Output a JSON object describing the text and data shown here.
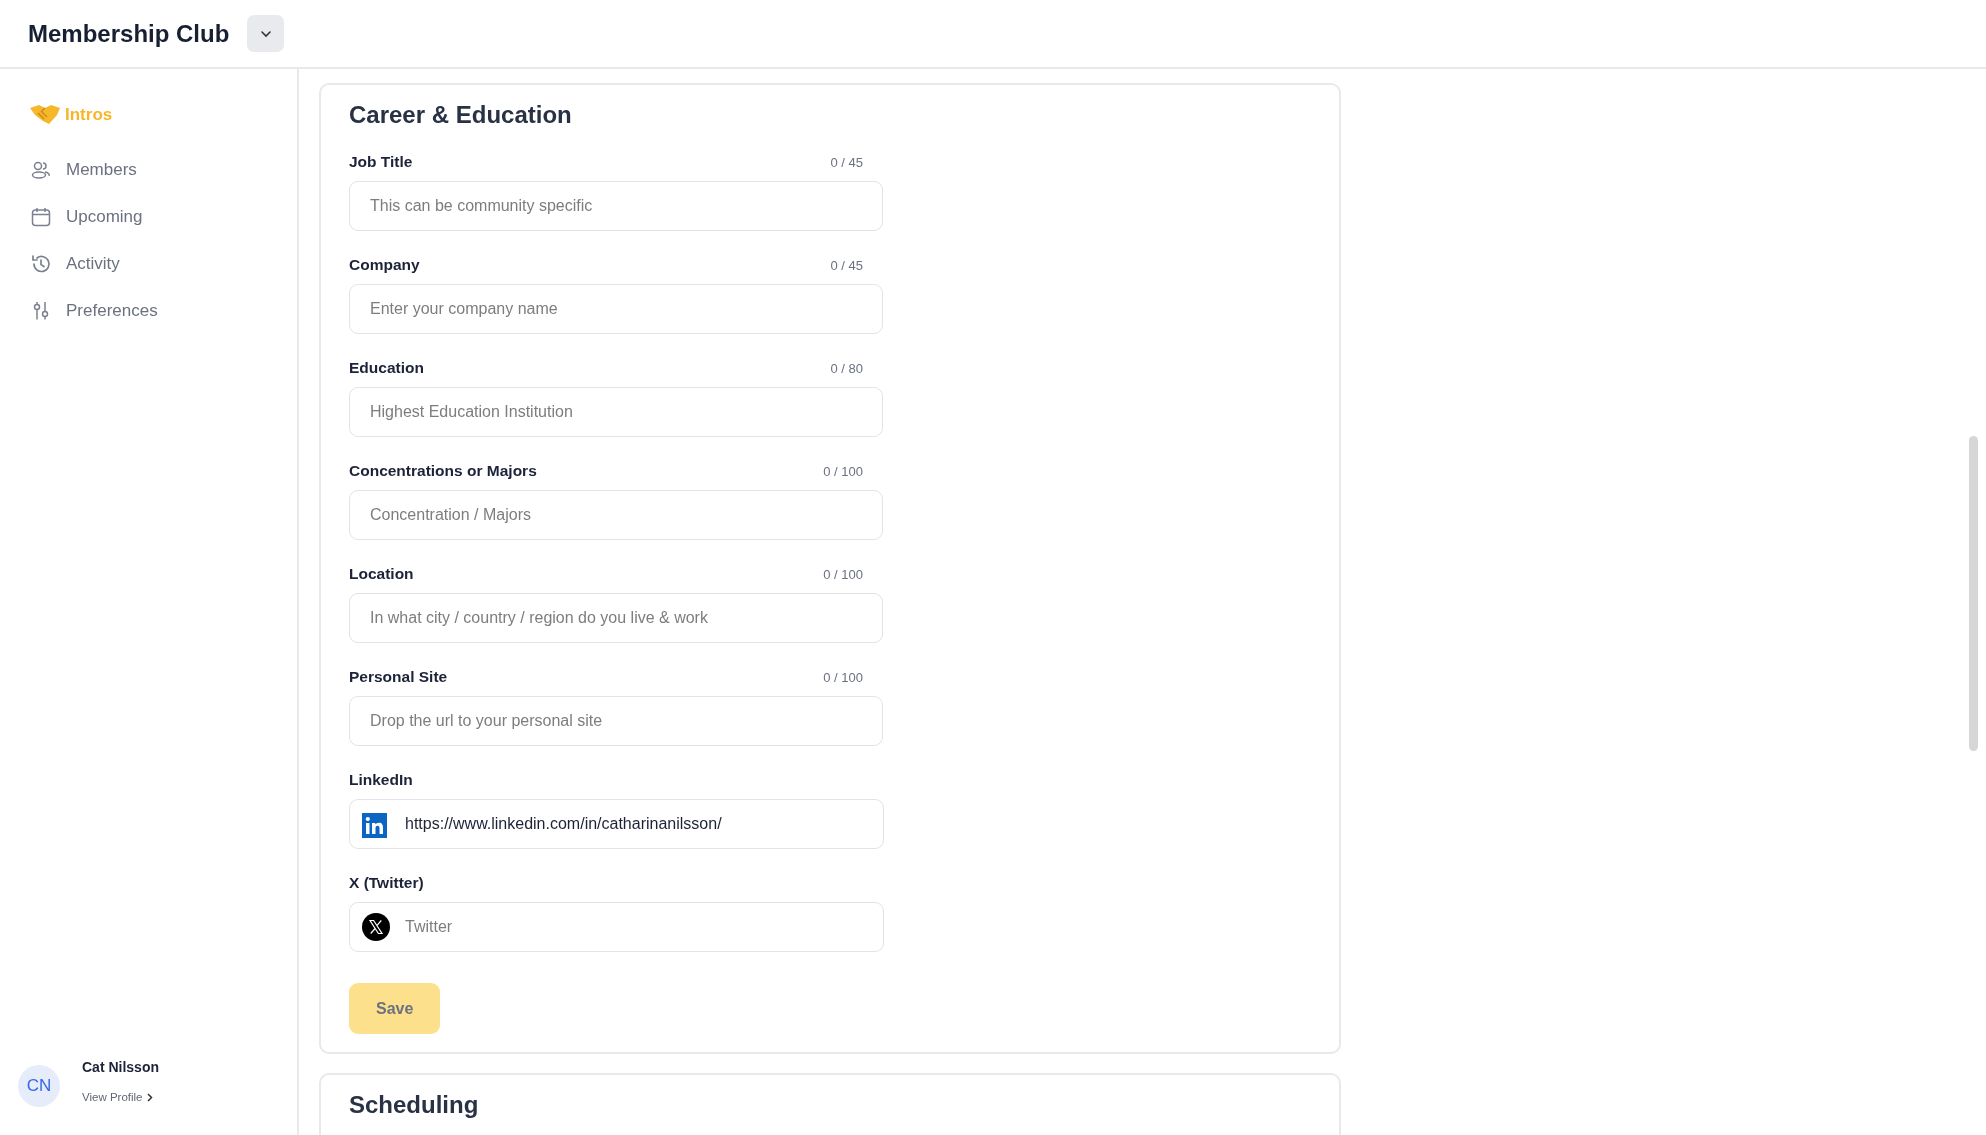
{
  "header": {
    "title": "Membership Club"
  },
  "sidebar": {
    "items": [
      {
        "label": "Intros",
        "selected": true
      },
      {
        "label": "Members",
        "selected": false
      },
      {
        "label": "Upcoming",
        "selected": false
      },
      {
        "label": "Activity",
        "selected": false
      },
      {
        "label": "Preferences",
        "selected": false
      }
    ],
    "user": {
      "initials": "CN",
      "name": "Cat Nilsson",
      "link": "View Profile"
    }
  },
  "cards": [
    {
      "title": "Career & Education",
      "fields": [
        {
          "kind": "counter",
          "label": "Job Title",
          "counter": "0 / 45",
          "placeholder": "This can be community specific"
        },
        {
          "kind": "counter",
          "label": "Company",
          "counter": "0 / 45",
          "placeholder": "Enter your company name"
        },
        {
          "kind": "counter",
          "label": "Education",
          "counter": "0 / 80",
          "placeholder": "Highest Education Institution"
        },
        {
          "kind": "counter",
          "label": "Concentrations or Majors",
          "counter": "0 / 100",
          "placeholder": "Concentration / Majors"
        },
        {
          "kind": "counter",
          "label": "Location",
          "counter": "0 / 100",
          "placeholder": "In what city / country / region do you live & work"
        },
        {
          "kind": "counter",
          "label": "Personal Site",
          "counter": "0 / 100",
          "placeholder": "Drop the url to your personal site"
        },
        {
          "kind": "linkedin",
          "label": "LinkedIn",
          "value": "https://www.linkedin.com/in/catharinanilsson/"
        },
        {
          "kind": "x",
          "label": "X (Twitter)",
          "placeholder": "Twitter"
        }
      ],
      "button": {
        "label": "Save",
        "disabled": true
      }
    },
    {
      "title": "Scheduling"
    }
  ]
}
